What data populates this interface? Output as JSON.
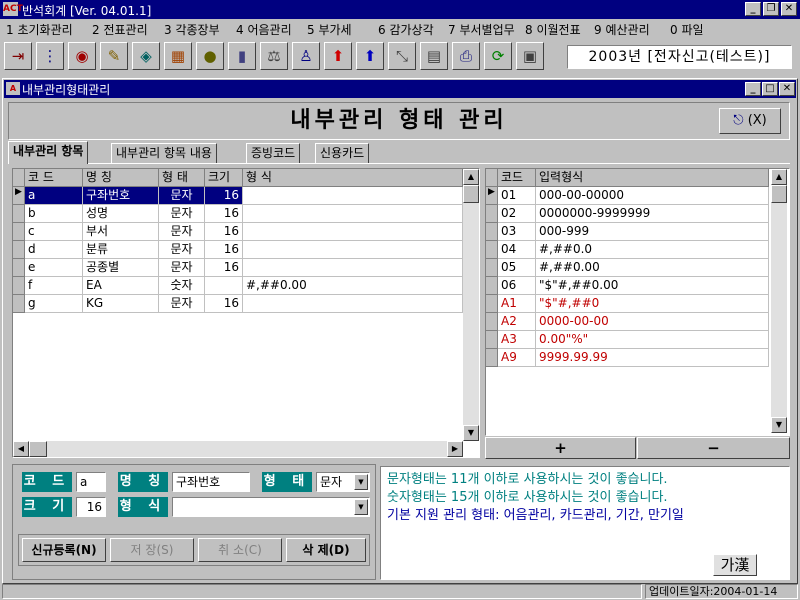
{
  "app": {
    "title": "반석회계 [Ver. 04.01.1]"
  },
  "menu": [
    "1 초기화관리",
    "2 전표관리",
    "3 각종장부",
    "4 어음관리",
    "5 부가세",
    "6 감가상각",
    "7 부서별업무",
    "8 이월전표",
    "9 예산관리",
    "0 파일"
  ],
  "toolbar": {
    "company_label": "2003년 [전자신고(테스트)]"
  },
  "window": {
    "title": "내부관리형태관리",
    "heading": "내부관리 형태 관리",
    "exit_label": "(X)"
  },
  "tabs": [
    "내부관리 항목",
    "내부관리 항목 내용",
    "증빙코드",
    "신용카드"
  ],
  "left_grid": {
    "columns": [
      "코 드",
      "명    칭",
      "형 태",
      "크기",
      "형 식"
    ],
    "rows": [
      {
        "code": "a",
        "name": "구좌번호",
        "type": "문자",
        "size": "16",
        "format": ""
      },
      {
        "code": "b",
        "name": "성명",
        "type": "문자",
        "size": "16",
        "format": ""
      },
      {
        "code": "c",
        "name": "부서",
        "type": "문자",
        "size": "16",
        "format": ""
      },
      {
        "code": "d",
        "name": "분류",
        "type": "문자",
        "size": "16",
        "format": ""
      },
      {
        "code": "e",
        "name": "공종별",
        "type": "문자",
        "size": "16",
        "format": ""
      },
      {
        "code": "f",
        "name": "EA",
        "type": "숫자",
        "size": "",
        "format": "#,##0.00"
      },
      {
        "code": "g",
        "name": "KG",
        "type": "문자",
        "size": "16",
        "format": ""
      }
    ]
  },
  "right_grid": {
    "columns": [
      "코드",
      "입력형식"
    ],
    "rows": [
      {
        "code": "01",
        "format": "000-00-00000",
        "red": false
      },
      {
        "code": "02",
        "format": "0000000-9999999",
        "red": false
      },
      {
        "code": "03",
        "format": "000-999",
        "red": false
      },
      {
        "code": "04",
        "format": "#,##0.0",
        "red": false
      },
      {
        "code": "05",
        "format": "#,##0.00",
        "red": false
      },
      {
        "code": "06",
        "format": "\"$\"#,##0.00",
        "red": false
      },
      {
        "code": "A1",
        "format": "\"$\"#,##0",
        "red": true
      },
      {
        "code": "A2",
        "format": "0000-00-00",
        "red": true
      },
      {
        "code": "A3",
        "format": "0.00\"%\"",
        "red": true
      },
      {
        "code": "A9",
        "format": "9999.99.99",
        "red": true
      }
    ],
    "add_label": "+",
    "remove_label": "−"
  },
  "form": {
    "code_label": "코 드",
    "code_value": "a",
    "name_label": "명 칭",
    "name_value": "구좌번호",
    "type_label": "형 태",
    "type_value": "문자",
    "size_label": "크 기",
    "size_value": "16",
    "format_label": "형 식",
    "format_value": ""
  },
  "buttons": {
    "new": "신규등록(N)",
    "save": "저 장(S)",
    "cancel": "취 소(C)",
    "delete": "삭 제(D)"
  },
  "messages": [
    "문자형태는 11개 이하로 사용하시는 것이 좋습니다.",
    "숫자형태는 15개 이하로 사용하시는 것이 좋습니다.",
    "기본 지원 관리 형태: 어음관리, 카드관리, 기간, 만기일"
  ],
  "ime_label": "가漢",
  "status": {
    "update_date": "업데이트일자:2004-01-14"
  },
  "colors": {
    "title_bg": "#000080",
    "label_green": "#008080",
    "red_text": "#c00000",
    "msg_blue": "#0000a0"
  }
}
